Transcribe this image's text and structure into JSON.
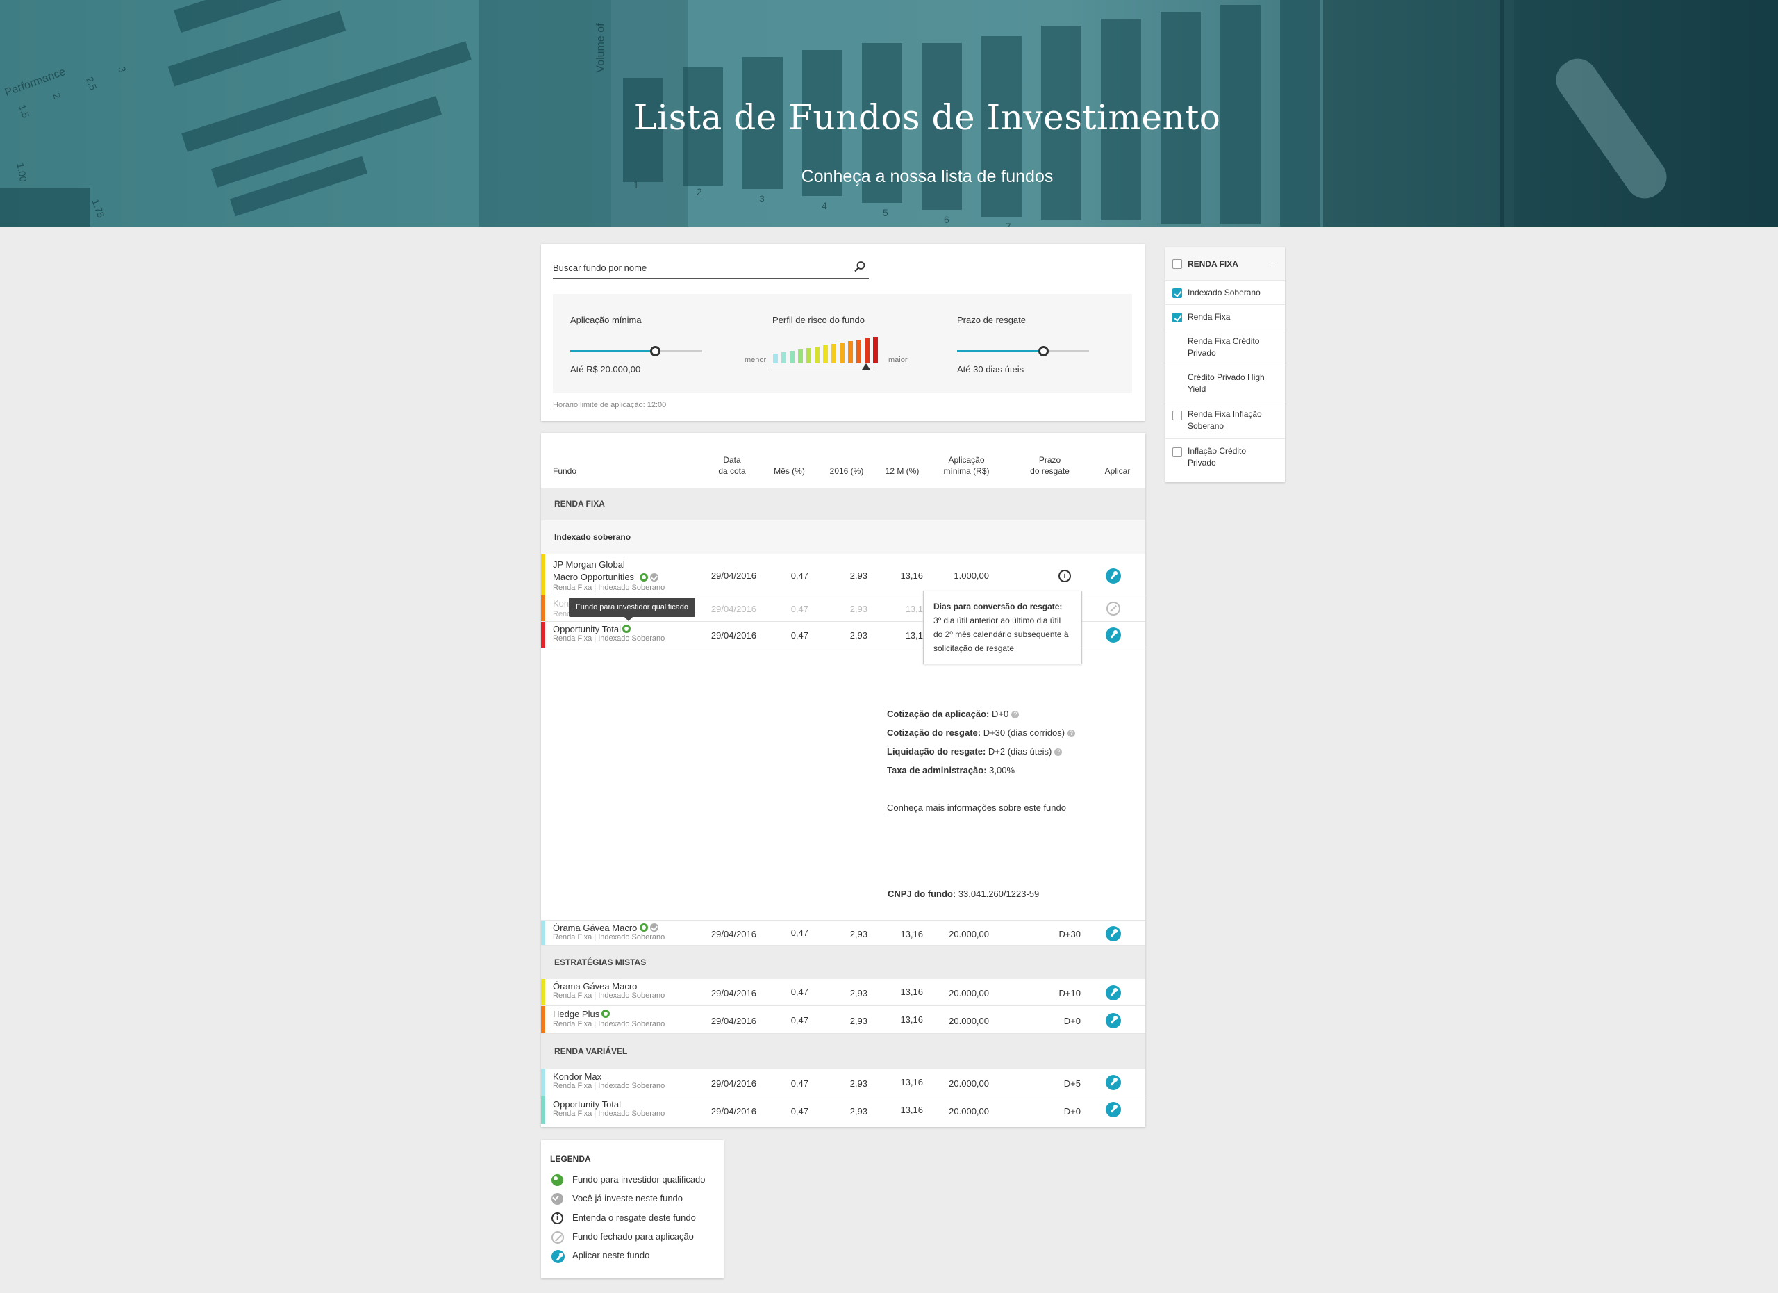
{
  "hero": {
    "title": "Lista de Fundos de Investimento",
    "subtitle": "Conheça a nossa lista de fundos",
    "chart_labels": {
      "performance": "Performance",
      "volume": "Volume of",
      "values": [
        "1.00",
        "1.5",
        "1.75",
        "2",
        "2.5",
        "3"
      ],
      "numbers": [
        "1",
        "2",
        "3",
        "4",
        "5",
        "6",
        "7"
      ]
    }
  },
  "filters": {
    "search_placeholder": "Buscar fundo por nome",
    "min_application": {
      "title": "Aplicação mínima",
      "value": "Até R$ 20.000,00",
      "fraction": 0.64
    },
    "risk_profile": {
      "title": "Perfil de risco do fundo",
      "low": "menor",
      "high": "maior",
      "selected_level": 12,
      "levels": 13
    },
    "redemption": {
      "title": "Prazo de resgate",
      "value": "Até 30 dias úteis",
      "fraction": 0.65
    },
    "cutoff": "Horário limite de aplicação: 12:00"
  },
  "table": {
    "headers": {
      "fund": "Fundo",
      "date_l1": "Data",
      "date_l2": "da cota",
      "month": "Mês (%)",
      "year2016": "2016 (%)",
      "m12": "12 M (%)",
      "min_l1": "Aplicação",
      "min_l2": "mínima (R$)",
      "prazo_l1": "Prazo",
      "prazo_l2": "do resgate",
      "apply": "Aplicar"
    },
    "group_renda_fixa": "RENDA FIXA",
    "sub_indexado": "Indexado soberano",
    "group_mistas": "ESTRATÉGIAS MISTAS",
    "group_variavel": "RENDA VARIÁVEL",
    "rows": [
      {
        "name1": "JP Morgan Global",
        "name2": "Macro Opportunities",
        "sub": "Renda Fixa | Indexado Soberano",
        "date": "29/04/2016",
        "month": "0,47",
        "y2016": "2,93",
        "m12": "13,16",
        "min": "1.000,00",
        "prazo": "",
        "color": "#f3d410"
      },
      {
        "name1": "Kon",
        "sub": "Rend",
        "date": "29/04/2016",
        "month": "0,47",
        "y2016": "2,93",
        "m12": "13,1",
        "color": "#f07a1a"
      },
      {
        "name1": "Opportunity Total",
        "sub": "Renda Fixa | Indexado Soberano",
        "date": "29/04/2016",
        "month": "0,47",
        "y2016": "2,93",
        "m12": "13,1",
        "color": "#e0242a"
      },
      {
        "name1": "Órama Gávea Macro",
        "sub": "Renda Fixa | Indexado Soberano",
        "date": "29/04/2016",
        "month": "0,47",
        "y2016": "2,93",
        "m12": "13,16",
        "min": "20.000,00",
        "prazo": "D+30",
        "color": "#a7e4ec"
      },
      {
        "name1": "Órama Gávea Macro",
        "sub": "Renda Fixa | Indexado Soberano",
        "date": "29/04/2016",
        "month": "0,47",
        "y2016": "2,93",
        "m12": "13,16",
        "min": "20.000,00",
        "prazo": "D+10",
        "color": "#e8e422"
      },
      {
        "name1": "Hedge Plus",
        "sub": "Renda Fixa | Indexado Soberano",
        "date": "29/04/2016",
        "month": "0,47",
        "y2016": "2,93",
        "m12": "13,16",
        "min": "20.000,00",
        "prazo": "D+0",
        "color": "#f07a1a"
      },
      {
        "name1": "Kondor Max",
        "sub": "Renda Fixa | Indexado Soberano",
        "date": "29/04/2016",
        "month": "0,47",
        "y2016": "2,93",
        "m12": "13,16",
        "min": "20.000,00",
        "prazo": "D+5",
        "color": "#a7e4ec"
      },
      {
        "name1": "Opportunity Total",
        "sub": "Renda Fixa | Indexado Soberano",
        "date": "29/04/2016",
        "month": "0,47",
        "y2016": "2,93",
        "m12": "13,16",
        "min": "20.000,00",
        "prazo": "D+0",
        "color": "#7fd9c8"
      }
    ],
    "tooltip_qualified": "Fundo para investidor qualificado",
    "popover": {
      "title": "Dias para conversão do resgate:",
      "l1": "3º dia útil anterior ao último dia útil",
      "l2": "do 2º mês calendário subsequente à",
      "l3": "solicitação de resgate"
    },
    "details": {
      "cot_aplic_label": "Cotização da aplicação:",
      "cot_aplic_val": " D+0",
      "cot_resg_label": "Cotização do resgate:",
      "cot_resg_val": " D+30 (dias corridos)",
      "liq_label": "Liquidação do resgate:",
      "liq_val": " D+2 (dias úteis)",
      "taxa_label": "Taxa de administração:",
      "taxa_val": " 3,00%",
      "more_link": "Conheça mais informações sobre este fundo",
      "cnpj_label": "CNPJ do fundo:",
      "cnpj_val": " 33.041.260/1223-59"
    }
  },
  "sidebar": {
    "header": "RENDA FIXA",
    "collapse": "–",
    "items": [
      {
        "label": "Indexado Soberano",
        "checked": true
      },
      {
        "label": "Renda Fixa",
        "checked": true
      },
      {
        "label": "Renda Fixa Crédito Privado",
        "checked": false,
        "hidden_box": true
      },
      {
        "label": "Crédito Privado High Yield",
        "checked": false,
        "hidden_box": true
      },
      {
        "label": "Renda Fixa Inflação Soberano",
        "checked": false
      },
      {
        "label": "Inflação Crédito Privado",
        "checked": false
      }
    ]
  },
  "legend": {
    "title": "LEGENDA",
    "items": [
      "Fundo para investidor qualificado",
      "Você já investe neste fundo",
      "Entenda o resgate deste fundo",
      "Fundo fechado para aplicação",
      "Aplicar neste fundo"
    ]
  },
  "colors": {
    "accent": "#1aa3c0",
    "qualified": "#4ba53a",
    "hero": "#4b8990"
  }
}
